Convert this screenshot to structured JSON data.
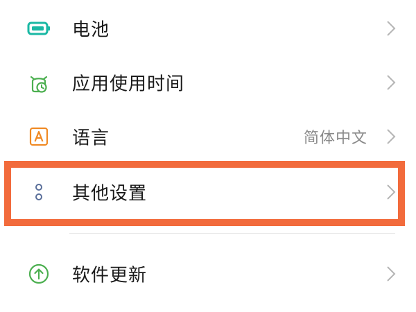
{
  "settings": {
    "items": [
      {
        "label": "电池",
        "value": "",
        "icon": "battery-icon",
        "accent": "#1ab8a4"
      },
      {
        "label": "应用使用时间",
        "value": "",
        "icon": "app-usage-time-icon",
        "accent": "#4caf50"
      },
      {
        "label": "语言",
        "value": "简体中文",
        "icon": "language-icon",
        "accent": "#f08a24"
      },
      {
        "label": "其他设置",
        "value": "",
        "icon": "more-settings-icon",
        "accent": "#5a6f9a"
      },
      {
        "label": "软件更新",
        "value": "",
        "icon": "software-update-icon",
        "accent": "#4caf50"
      }
    ]
  },
  "colors": {
    "highlight_border": "#f26b3c",
    "text_primary": "#1a1a1a",
    "text_secondary": "#8a8a8a",
    "chevron": "#b5b5b5"
  }
}
